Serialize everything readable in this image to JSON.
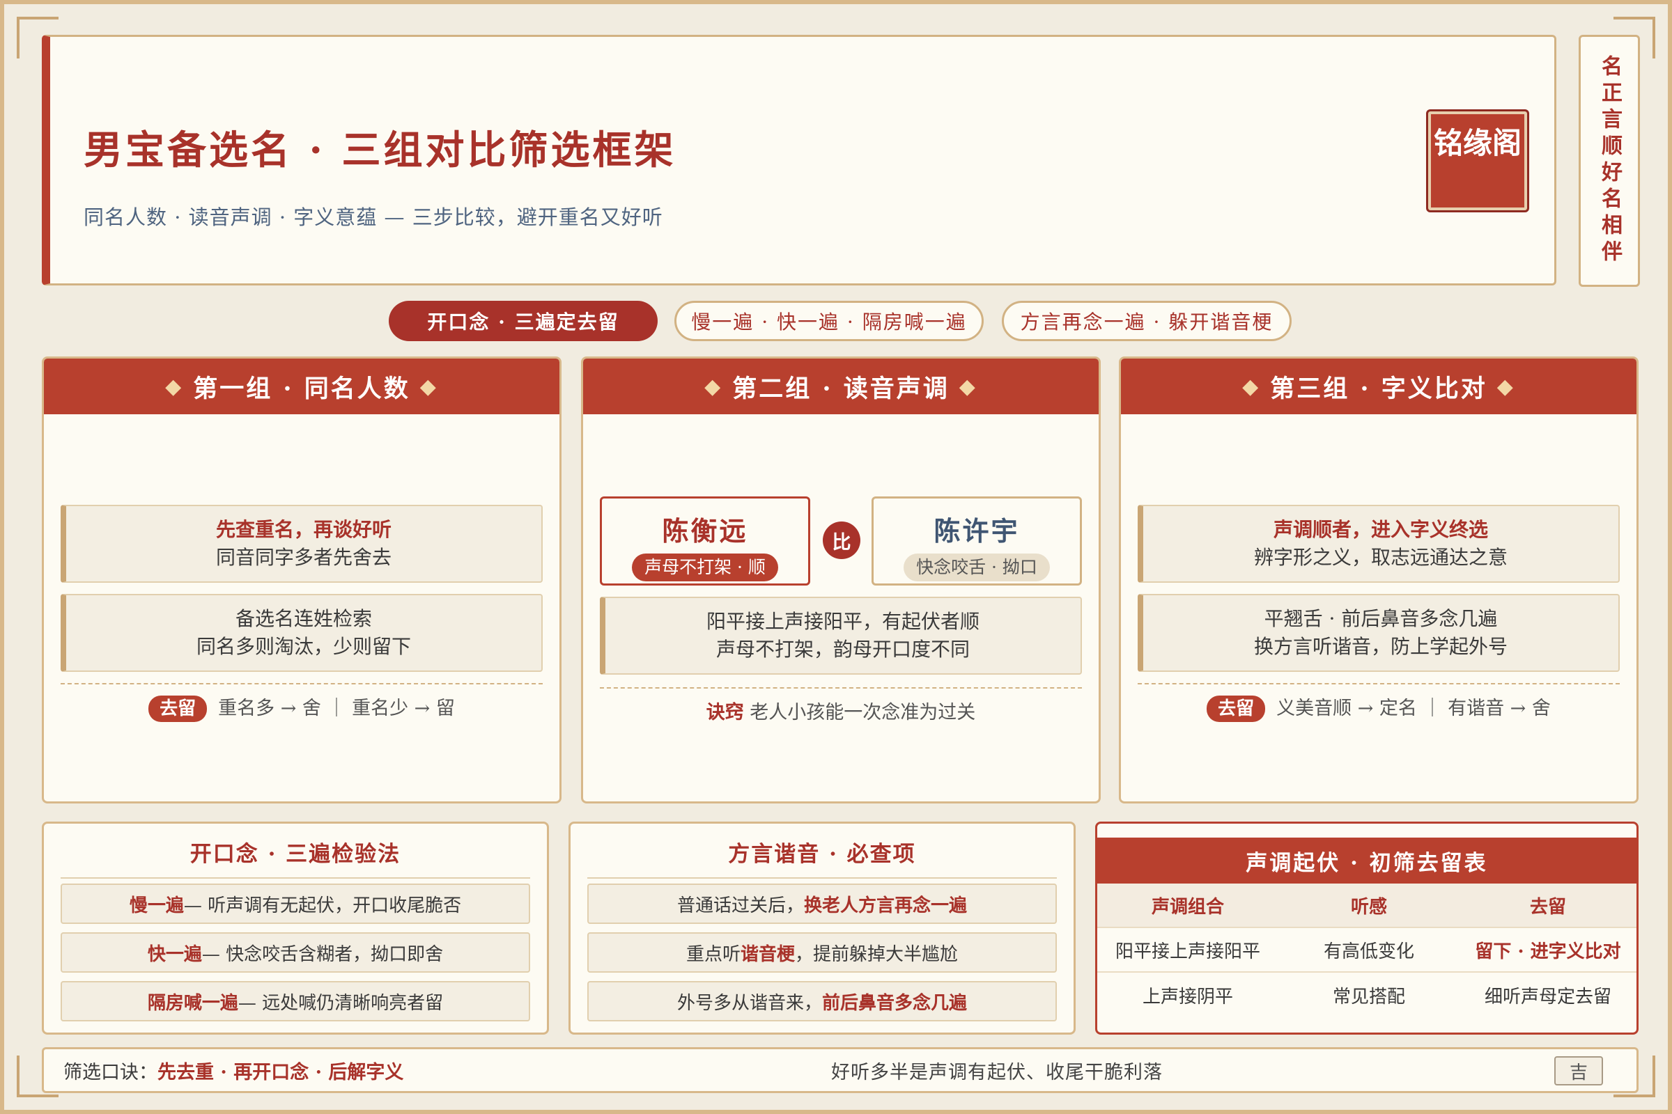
{
  "header": {
    "title": "男宝备选名 · 三组对比筛选框架",
    "subtitle": "同名人数 · 读音声调 · 字义意蕴 — 三步比较，避开重名又好听",
    "seal": "铭缘阁",
    "side_banner": "名正言顺好名相伴"
  },
  "pills": [
    "开口念 · 三遍定去留",
    "慢一遍 · 快一遍 · 隔房喊一遍",
    "方言再念一遍 · 躲开谐音梗"
  ],
  "group1": {
    "title": "第一组 · 同名人数",
    "box1_line1": "先查重名，再谈好听",
    "box1_line2": "同音同字多者先舍去",
    "box2_line1": "备选名连姓检索",
    "box2_line2": "同名多则淘汰，少则留下",
    "tag": "去留",
    "rule": "重名多 → 舍 ｜ 重名少 → 留"
  },
  "group2": {
    "title": "第二组 · 读音声调",
    "name_a": "陈衡远",
    "badge_a": "声母不打架 · 顺",
    "vs": "比",
    "name_b": "陈许宇",
    "badge_b": "快念咬舌 · 拗口",
    "box_line1": "阳平接上声接阳平，有起伏者顺",
    "box_line2": "声母不打架，韵母开口度不同",
    "tip_label": "诀窍",
    "tip_text": "老人小孩能一次念准为过关"
  },
  "group3": {
    "title": "第三组 · 字义比对",
    "box1_line1": "声调顺者，进入字义终选",
    "box1_line2": "辨字形之义，取志远通达之意",
    "box2_line1": "平翘舌 · 前后鼻音多念几遍",
    "box2_line2": "换方言听谐音，防上学起外号",
    "tag": "去留",
    "rule": "义美音顺 → 定名 ｜ 有谐音 → 舍"
  },
  "panel1": {
    "title": "开口念 · 三遍检验法",
    "rows": [
      {
        "label": "慢一遍",
        "text": " — 听声调有无起伏，开口收尾脆否"
      },
      {
        "label": "快一遍",
        "text": " — 快念咬舌含糊者，拗口即舍"
      },
      {
        "label": "隔房喊一遍",
        "text": " — 远处喊仍清晰响亮者留"
      }
    ]
  },
  "panel2": {
    "title": "方言谐音 · 必查项",
    "rows": [
      {
        "pre": "普通话过关后，",
        "hl": "换老人方言再念一遍",
        "post": ""
      },
      {
        "pre": "重点听",
        "hl": "谐音梗",
        "post": "，提前躲掉大半尴尬"
      },
      {
        "pre": "外号多从谐音来，",
        "hl": "前后鼻音多念几遍",
        "post": ""
      }
    ]
  },
  "table": {
    "title": "声调起伏 · 初筛去留表",
    "headers": [
      "声调组合",
      "听感",
      "去留"
    ],
    "rows": [
      [
        "阳平接上声接阳平",
        "有高低变化",
        "留下 · 进字义比对"
      ],
      [
        "上声接阴平",
        "常见搭配",
        "细听声母定去留"
      ]
    ]
  },
  "footer": {
    "label": "筛选口诀：",
    "motto": "先去重 · 再开口念 · 后解字义",
    "middle": "好听多半是声调有起伏、收尾干脆利落",
    "stamp": "吉"
  },
  "colors": {
    "accent": "#b8402e",
    "gold": "#d2b283",
    "paper": "#fdfbf3",
    "navy": "#4f6480"
  }
}
